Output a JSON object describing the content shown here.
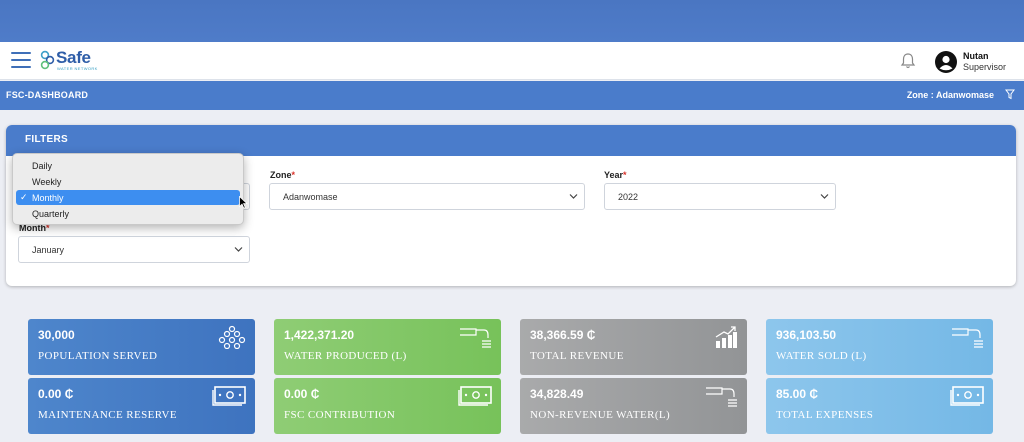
{
  "app": {
    "logo_text": "Safe",
    "logo_subtext": "WATER NETWORK"
  },
  "user": {
    "name": "Nutan",
    "role": "Supervisor"
  },
  "subbar": {
    "title": "FSC-DASHBOARD",
    "zone_text": "Zone : Adanwomase"
  },
  "filters": {
    "title": "FILTERS",
    "zone": {
      "label": "Zone",
      "value": "Adanwomase"
    },
    "year": {
      "label": "Year",
      "value": "2022"
    },
    "month": {
      "label": "Month",
      "value": "January"
    },
    "period_dropdown": {
      "options": [
        "Daily",
        "Weekly",
        "Monthly",
        "Quarterly"
      ],
      "selected": "Monthly"
    }
  },
  "cards": [
    {
      "value": "30,000",
      "label": "POPULATION SERVED",
      "icon": "population-icon",
      "color": "#3e73bf"
    },
    {
      "value": "1,422,371.20",
      "label": "WATER PRODUCED (L)",
      "icon": "water-tap-icon",
      "color": "#77c25a"
    },
    {
      "value": "38,366.59 ₵",
      "label": "TOTAL REVENUE",
      "icon": "revenue-chart-icon",
      "color": "#929496"
    },
    {
      "value": "936,103.50",
      "label": "WATER SOLD (L)",
      "icon": "water-tap-icon",
      "color": "#74b8e6"
    },
    {
      "value": "0.00 ₵",
      "label": "MAINTENANCE RESERVE",
      "icon": "cash-icon",
      "color": "#3e73bf"
    },
    {
      "value": "0.00 ₵",
      "label": "FSC CONTRIBUTION",
      "icon": "cash-icon",
      "color": "#77c25a"
    },
    {
      "value": "34,828.49",
      "label": "NON-REVENUE WATER(L)",
      "icon": "water-tap-icon",
      "color": "#929496"
    },
    {
      "value": "85.00 ₵",
      "label": "TOTAL EXPENSES",
      "icon": "cash-icon",
      "color": "#74b8e6"
    }
  ]
}
